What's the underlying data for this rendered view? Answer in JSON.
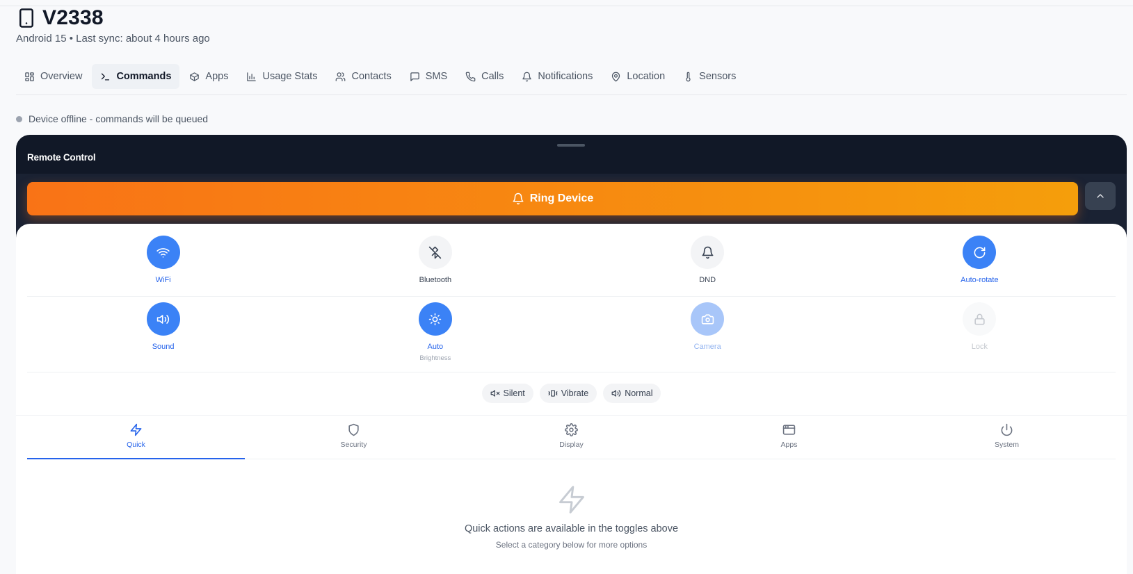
{
  "device": {
    "name": "V2338",
    "subtitle": "Android 15 • Last sync: about 4 hours ago",
    "icon": "smartphone-icon"
  },
  "tabs": [
    {
      "label": "Overview",
      "icon": "layout-grid-icon",
      "active": false
    },
    {
      "label": "Commands",
      "icon": "terminal-icon",
      "active": true
    },
    {
      "label": "Apps",
      "icon": "package-icon",
      "active": false
    },
    {
      "label": "Usage Stats",
      "icon": "bar-chart-icon",
      "active": false
    },
    {
      "label": "Contacts",
      "icon": "users-icon",
      "active": false
    },
    {
      "label": "SMS",
      "icon": "message-square-icon",
      "active": false
    },
    {
      "label": "Calls",
      "icon": "phone-icon",
      "active": false
    },
    {
      "label": "Notifications",
      "icon": "bell-icon",
      "active": false
    },
    {
      "label": "Location",
      "icon": "map-pin-icon",
      "active": false
    },
    {
      "label": "Sensors",
      "icon": "thermometer-icon",
      "active": false
    }
  ],
  "status": {
    "text": "Device offline - commands will be queued",
    "dot_color": "#9ca3af"
  },
  "remote": {
    "title": "Remote Control",
    "ring_label": "Ring Device",
    "ring_gradient": [
      "#f97316",
      "#f59e0b"
    ],
    "accent": "#3b82f6"
  },
  "toggles_row1": [
    {
      "label": "WiFi",
      "icon": "wifi-icon",
      "state": "on"
    },
    {
      "label": "Bluetooth",
      "icon": "bluetooth-off-icon",
      "state": "off"
    },
    {
      "label": "DND",
      "icon": "bell-icon",
      "state": "off"
    },
    {
      "label": "Auto-rotate",
      "icon": "rotate-cw-icon",
      "state": "on"
    }
  ],
  "toggles_row2": [
    {
      "label": "Sound",
      "icon": "volume-icon",
      "state": "on",
      "sub": ""
    },
    {
      "label": "Auto",
      "icon": "sun-icon",
      "state": "on",
      "sub": "Brightness"
    },
    {
      "label": "Camera",
      "icon": "camera-icon",
      "state": "dim",
      "sub": ""
    },
    {
      "label": "Lock",
      "icon": "lock-icon",
      "state": "disabled",
      "sub": ""
    }
  ],
  "sound_modes": [
    {
      "label": "Silent",
      "icon": "volume-x-icon"
    },
    {
      "label": "Vibrate",
      "icon": "vibrate-icon"
    },
    {
      "label": "Normal",
      "icon": "volume-icon"
    }
  ],
  "categories": [
    {
      "label": "Quick",
      "icon": "zap-icon",
      "active": true
    },
    {
      "label": "Security",
      "icon": "shield-icon",
      "active": false
    },
    {
      "label": "Display",
      "icon": "settings-icon",
      "active": false
    },
    {
      "label": "Apps",
      "icon": "app-window-icon",
      "active": false
    },
    {
      "label": "System",
      "icon": "power-icon",
      "active": false
    }
  ],
  "empty": {
    "icon": "zap-icon",
    "main": "Quick actions are available in the toggles above",
    "sub": "Select a category below for more options"
  }
}
